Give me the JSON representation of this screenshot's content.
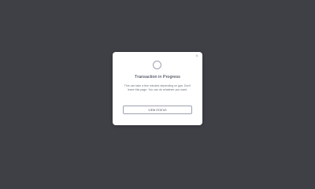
{
  "modal": {
    "close_label": "×",
    "title": "Transaction in Progress",
    "description": "This can take a few minutes depending on gas. Don't leave this page. You can do whatever you want.",
    "button_label": "VIEW STATUS"
  },
  "colors": {
    "backdrop": "#3f3f46",
    "modal_bg": "#ffffff",
    "title": "#1f2937",
    "text": "#6b7280",
    "border": "#9ca3af"
  },
  "icons": {
    "spinner": "loading-spinner-icon",
    "close": "close-icon"
  }
}
